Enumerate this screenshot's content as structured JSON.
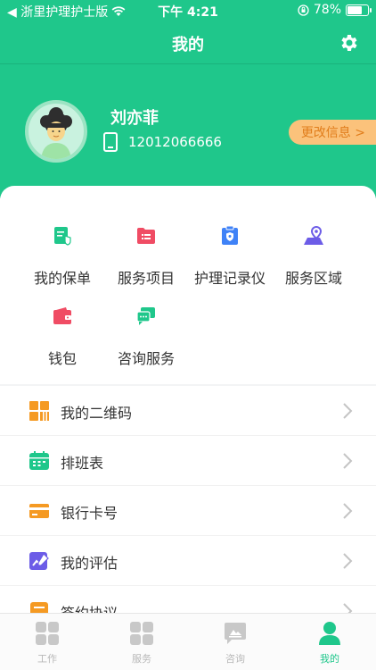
{
  "status_bar": {
    "carrier": "◀ 浙里护理护士版",
    "time": "下午 4:21",
    "battery": "78%",
    "battery_level": 0.78
  },
  "nav": {
    "title": "我的",
    "settings_icon": "gear-icon"
  },
  "profile": {
    "name": "刘亦菲",
    "phone": "12012066666",
    "edit_label": "更改信息 >"
  },
  "services": [
    {
      "label": "我的保单",
      "icon": "policy-icon",
      "color": "#1fc78b"
    },
    {
      "label": "服务项目",
      "icon": "service-items-icon",
      "color": "#f04c64"
    },
    {
      "label": "护理记录仪",
      "icon": "recorder-icon",
      "color": "#3f82f7"
    },
    {
      "label": "服务区域",
      "icon": "map-pin-icon",
      "color": "#6c5ce7"
    },
    {
      "label": "钱包",
      "icon": "wallet-icon",
      "color": "#f04c64"
    },
    {
      "label": "咨询服务",
      "icon": "chat-icon",
      "color": "#1fc78b"
    }
  ],
  "menu": [
    {
      "label": "我的二维码",
      "icon": "qr-code-icon",
      "color": "#f59a23"
    },
    {
      "label": "排班表",
      "icon": "calendar-icon",
      "color": "#1fc78b"
    },
    {
      "label": "银行卡号",
      "icon": "bank-card-icon",
      "color": "#f59a23"
    },
    {
      "label": "我的评估",
      "icon": "assessment-icon",
      "color": "#6c5ce7"
    },
    {
      "label": "签约协议",
      "icon": "agreement-icon",
      "color": "#f59a23"
    }
  ],
  "tabs": [
    {
      "label": "工作",
      "active": false
    },
    {
      "label": "服务",
      "active": false
    },
    {
      "label": "咨询",
      "active": false
    },
    {
      "label": "我的",
      "active": true
    }
  ],
  "colors": {
    "primary": "#1fc78b",
    "tab_inactive": "#b8b8b8",
    "accent_orange": "#fbc27b"
  }
}
